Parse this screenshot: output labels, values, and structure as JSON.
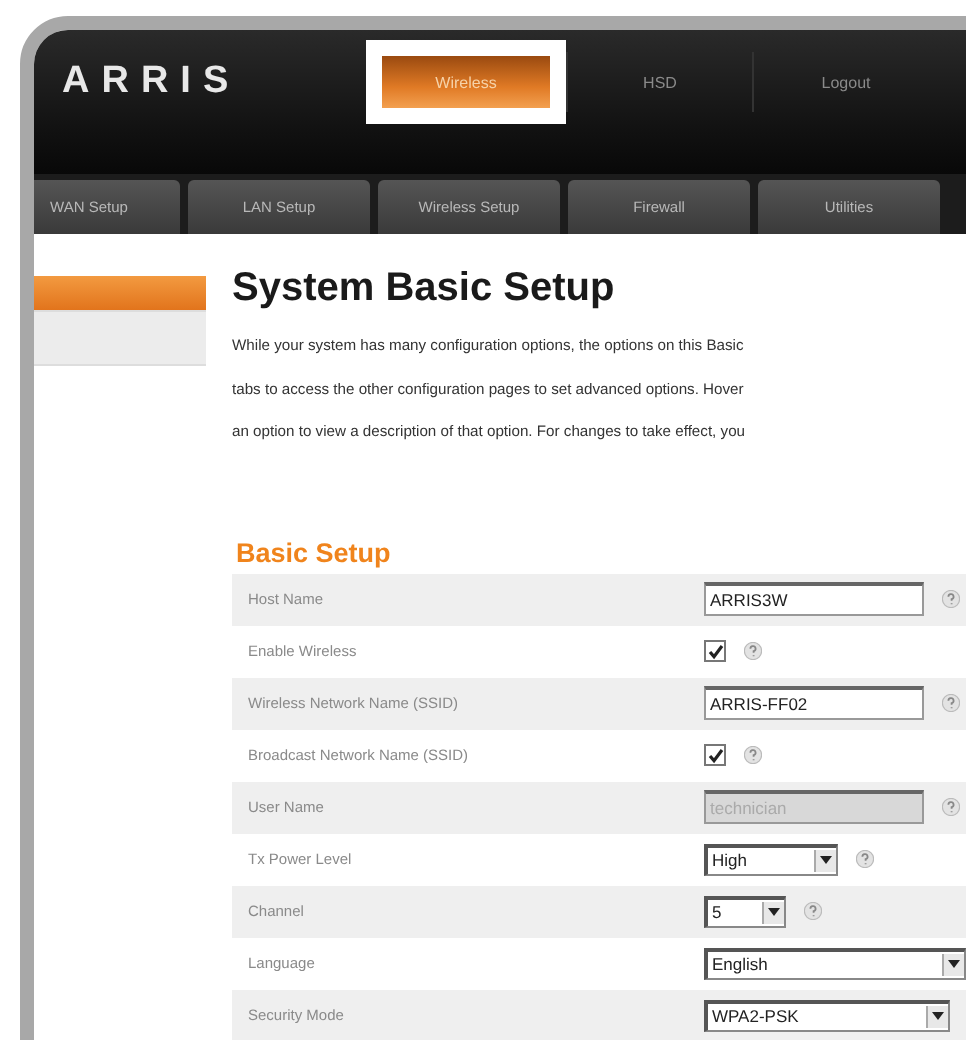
{
  "header": {
    "logo": "ARRIS",
    "nav": [
      {
        "label": "Wireless",
        "selected": true
      },
      {
        "label": "HSD",
        "selected": false
      },
      {
        "label": "Logout",
        "selected": false
      }
    ]
  },
  "tabs": [
    {
      "label": "WAN Setup",
      "selected": false
    },
    {
      "label": "LAN Setup",
      "selected": false
    },
    {
      "label": "Wireless Setup",
      "selected": false
    },
    {
      "label": "Firewall",
      "selected": false
    },
    {
      "label": "Utilities",
      "selected": false
    }
  ],
  "sidebar": {
    "items": [
      {
        "selected": true
      },
      {
        "selected": false
      }
    ]
  },
  "page": {
    "title": "System Basic Setup",
    "description": [
      "While your system has many configuration options, the options on this Basic",
      "tabs to access the other configuration pages to set advanced options. Hover",
      "an option to view a description of that option. For changes to take effect, you"
    ]
  },
  "section": {
    "title": "Basic Setup",
    "rows": [
      {
        "label": "Host Name",
        "kind": "text",
        "value": "ARRIS3W",
        "disabled": false,
        "help": true
      },
      {
        "label": "Enable Wireless",
        "kind": "checkbox",
        "checked": true
      },
      {
        "label": "Wireless Network Name (SSID)",
        "kind": "text",
        "value": "ARRIS-FF02",
        "disabled": false,
        "help": true
      },
      {
        "label": "Broadcast Network Name (SSID)",
        "kind": "checkbox",
        "checked": true
      },
      {
        "label": "User Name",
        "kind": "text",
        "value": "technician",
        "disabled": true,
        "help": true
      },
      {
        "label": "Tx Power Level",
        "kind": "select",
        "value": "High"
      },
      {
        "label": "Channel",
        "kind": "select",
        "value": "5"
      },
      {
        "label": "Language",
        "kind": "select",
        "value": "English",
        "help": false
      },
      {
        "label": "Security Mode",
        "kind": "select",
        "value": "WPA2-PSK"
      }
    ]
  }
}
